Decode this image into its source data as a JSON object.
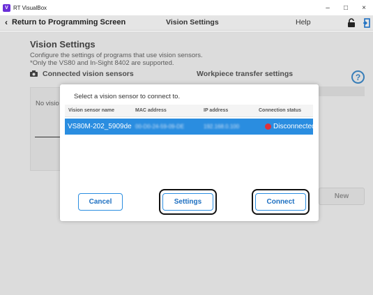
{
  "window": {
    "app_icon_letter": "V",
    "title": "RT VisualBox",
    "controls": {
      "minimize": "–",
      "maximize": "□",
      "close": "×"
    }
  },
  "navbar": {
    "back_label": "Return to Programming Screen",
    "back_icon": "chevron-left-icon",
    "title": "Vision Settings",
    "help_label": "Help",
    "lock_icon": "lock-icon",
    "exit_icon": "exit-door-icon"
  },
  "page": {
    "title": "Vision Settings",
    "description_line1": "Configure the settings of programs that use vision sensors.",
    "description_line2": "*Only the VS80 and In-Sight 8402 are supported.",
    "connected_section": "Connected vision sensors",
    "transfer_section": "Workpiece transfer settings",
    "help_symbol": "?",
    "left_panel_text": "No visio",
    "new_button": "New"
  },
  "modal": {
    "prompt": "Select a vision sensor to connect to.",
    "columns": [
      "Vision sensor name",
      "MAC address",
      "IP address",
      "Connection status"
    ],
    "rows": [
      {
        "name": "VS80M-202_5909de",
        "mac": "00-D0-24-59-09-DE",
        "ip": "192.168.0.100",
        "status": "Disconnected",
        "status_color": "#e0313b",
        "selected": true
      }
    ],
    "buttons": {
      "cancel": "Cancel",
      "settings": "Settings",
      "connect": "Connect"
    }
  },
  "colors": {
    "accent": "#2a8de0",
    "selection": "#2a8de0",
    "disconnected": "#e0313b"
  }
}
